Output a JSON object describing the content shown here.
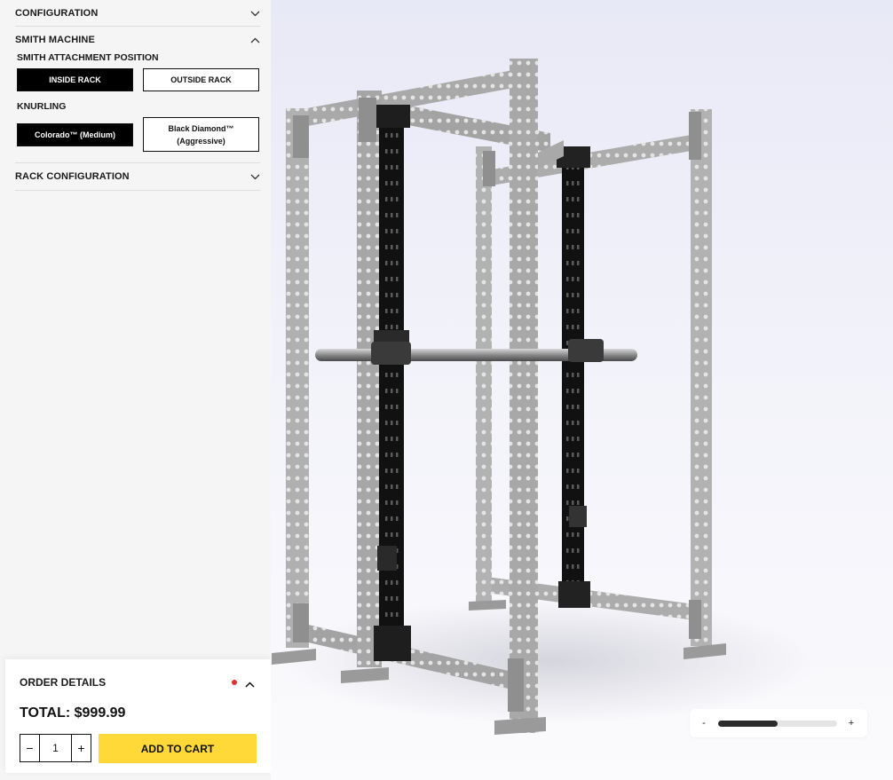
{
  "sidebar": {
    "sections": {
      "configuration": {
        "label": "CONFIGURATION",
        "expanded": false
      },
      "smith_machine": {
        "label": "SMITH MACHINE",
        "expanded": true,
        "attachment": {
          "label": "SMITH ATTACHMENT POSITION",
          "options": [
            "INSIDE RACK",
            "OUTSIDE RACK"
          ],
          "selected": "INSIDE RACK"
        },
        "knurling": {
          "label": "KNURLING",
          "options": [
            "Colorado™ (Medium)",
            "Black Diamond™\n(Aggressive)"
          ],
          "option_lines": [
            [
              "Colorado™ (Medium)"
            ],
            [
              "Black Diamond™",
              "(Aggressive)"
            ]
          ],
          "selected": "Colorado™ (Medium)"
        }
      },
      "rack_configuration": {
        "label": "RACK CONFIGURATION",
        "expanded": false
      }
    }
  },
  "order": {
    "title": "ORDER DETAILS",
    "total": "TOTAL: $999.99",
    "quantity": "1",
    "minus": "−",
    "plus": "+",
    "add_to_cart": "ADD TO CART",
    "accent_color": "#ffd938",
    "dot_color": "#e03131"
  },
  "viewer": {
    "zoom": {
      "minus": "-",
      "plus": "+",
      "level": 0.5
    }
  }
}
